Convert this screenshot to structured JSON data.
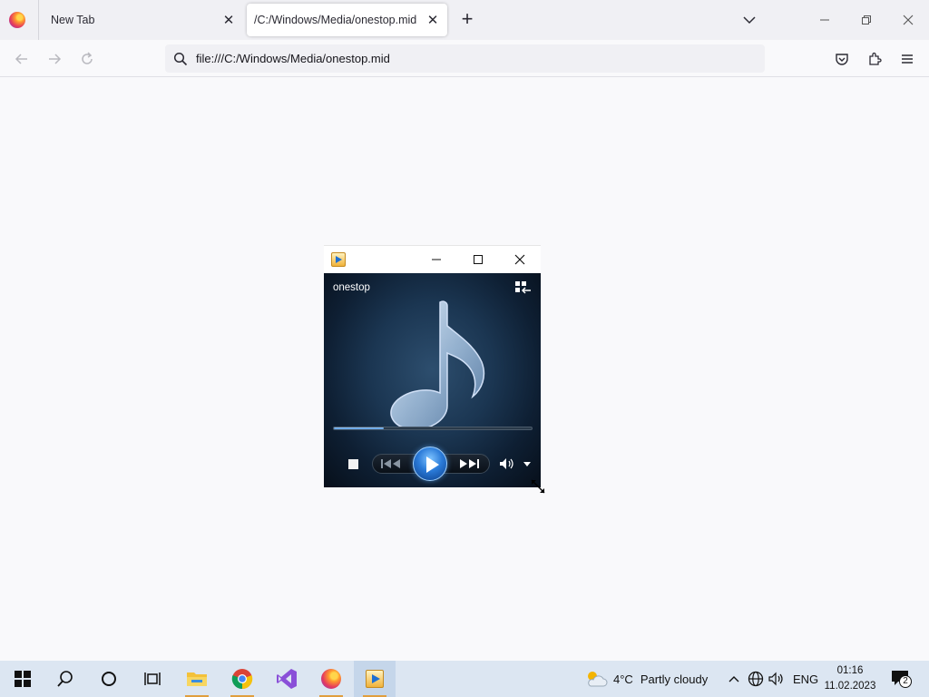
{
  "browser": {
    "tabs": [
      {
        "title": "New Tab",
        "active": false
      },
      {
        "title": "/C:/Windows/Media/onestop.mid",
        "active": true
      }
    ],
    "url": "file:///C:/Windows/Media/onestop.mid"
  },
  "player": {
    "track_name": "onestop",
    "seek_progress": 0.25,
    "accent": "#2a7ad8"
  },
  "taskbar": {
    "weather_temp": "4°C",
    "weather_desc": "Partly cloudy",
    "language": "ENG",
    "time": "01:16",
    "date": "11.02.2023",
    "notification_count": "2",
    "apps": [
      "start-icon",
      "search-icon",
      "cortana-icon",
      "task-view-icon",
      "file-explorer-icon",
      "chrome-icon",
      "visual-studio-icon",
      "firefox-icon",
      "media-player-icon"
    ]
  }
}
